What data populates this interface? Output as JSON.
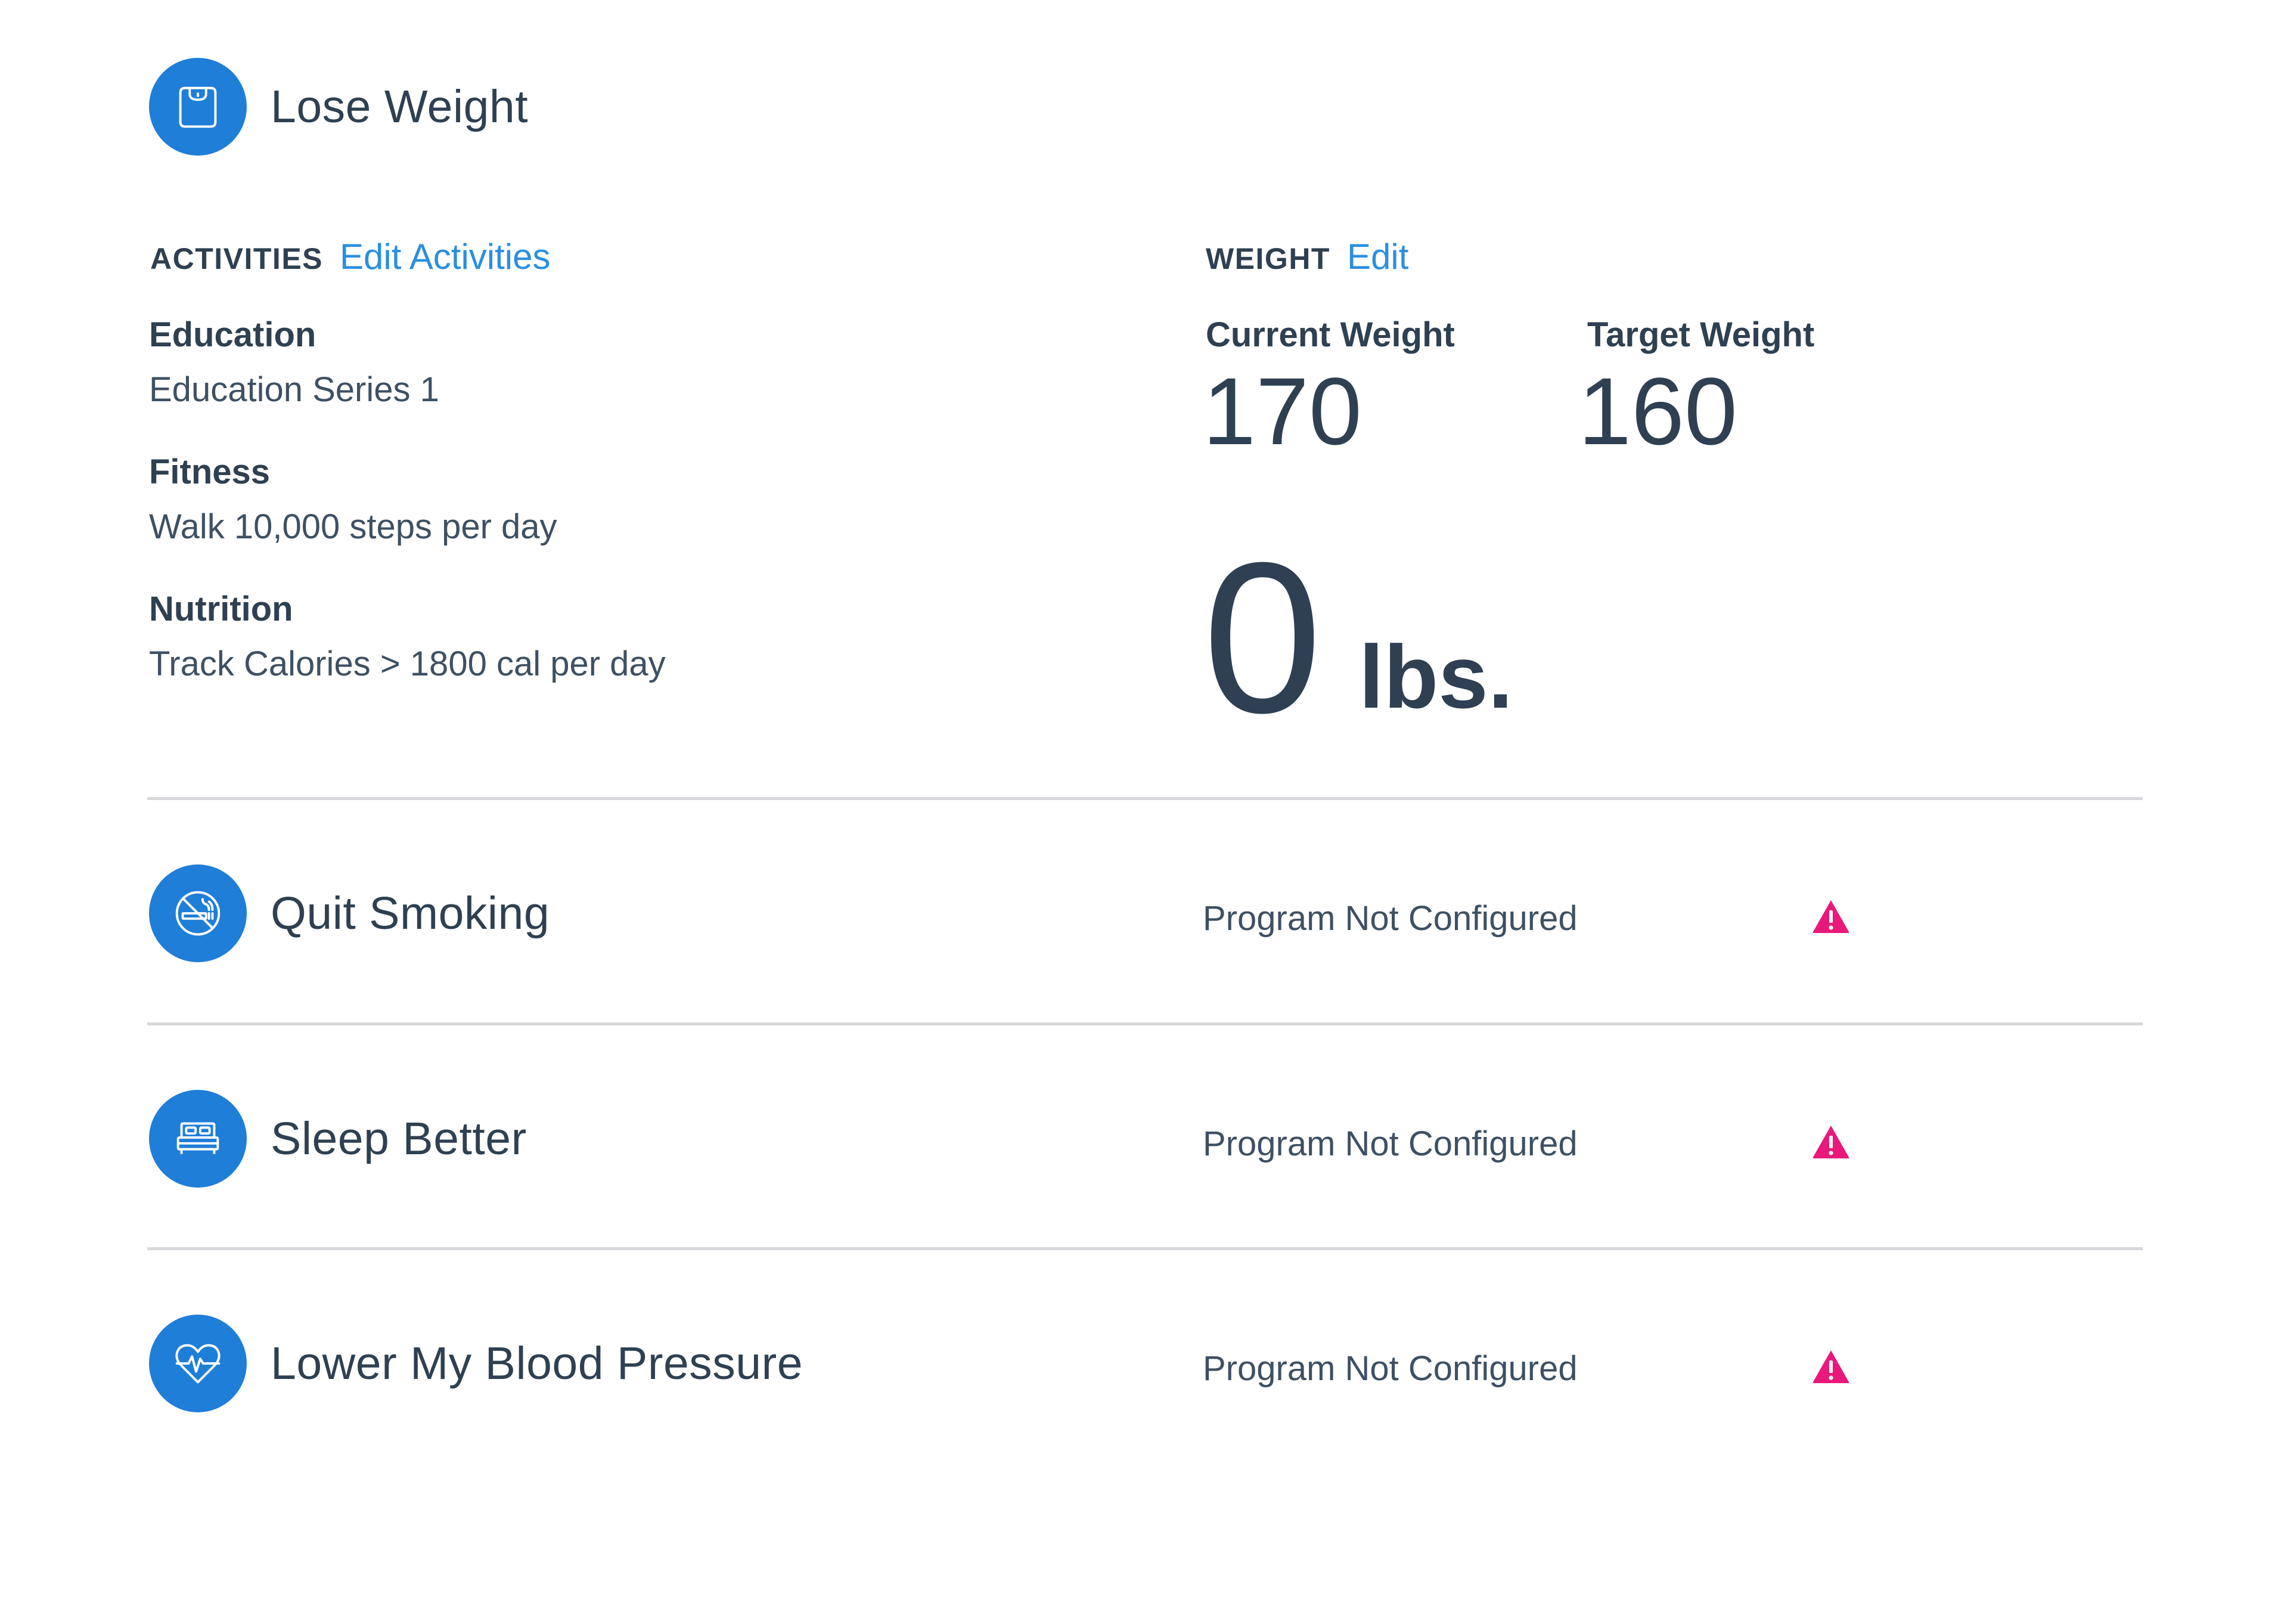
{
  "programs": [
    {
      "title": "Lose Weight",
      "icon": "scale-icon"
    },
    {
      "title": "Quit Smoking",
      "icon": "no-smoking-icon",
      "status": "Program Not Configured",
      "status_icon": "warning-icon"
    },
    {
      "title": "Sleep Better",
      "icon": "bed-icon",
      "status": "Program Not Configured",
      "status_icon": "warning-icon"
    },
    {
      "title": "Lower My Blood Pressure",
      "icon": "heart-pulse-icon",
      "status": "Program Not Configured",
      "status_icon": "warning-icon"
    }
  ],
  "activities": {
    "label": "ACTIVITIES",
    "edit_link": "Edit Activities",
    "items": [
      {
        "title": "Education",
        "value": "Education Series 1"
      },
      {
        "title": "Fitness",
        "value": "Walk 10,000 steps per day"
      },
      {
        "title": "Nutrition",
        "value": "Track Calories > 1800 cal per day"
      }
    ]
  },
  "weight": {
    "label": "WEIGHT",
    "edit_link": "Edit",
    "current_label": "Current Weight",
    "current_value": "170",
    "target_label": "Target Weight",
    "target_value": "160",
    "lost_value": "0",
    "lost_unit": "lbs."
  },
  "colors": {
    "accent_blue": "#1f7ed8",
    "link_blue": "#2a8fe0",
    "text_dark": "#2e4052",
    "warning_pink": "#e8197a",
    "divider": "#d6d8db"
  }
}
